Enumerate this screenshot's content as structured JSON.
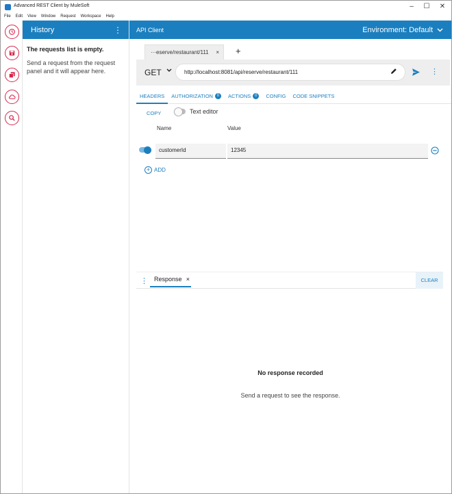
{
  "window": {
    "title": "Advanced REST Client by MuleSoft"
  },
  "menu": [
    "File",
    "Edit",
    "View",
    "Window",
    "Request",
    "Workspace",
    "Help"
  ],
  "colors": {
    "brand": "#1b7fbf",
    "rail_accent": "#d8244a"
  },
  "rail": [
    {
      "name": "history-icon"
    },
    {
      "name": "save-icon"
    },
    {
      "name": "projects-icon"
    },
    {
      "name": "cloud-icon"
    },
    {
      "name": "search-icon"
    }
  ],
  "history": {
    "title": "History",
    "empty_title": "The requests list is empty.",
    "empty_desc": "Send a request from the request panel and it will appear here."
  },
  "main": {
    "title": "API Client",
    "environment": "Environment: Default",
    "tab_label": "···eserve/restaurant/111",
    "tab_close": "×",
    "add_tab": "+",
    "method": "GET",
    "url": "http://localhost:8081/api/reserve/restaurant/111",
    "subtabs": [
      {
        "label": "HEADERS",
        "badge": ""
      },
      {
        "label": "AUTHORIZATION",
        "badge": "0"
      },
      {
        "label": "ACTIONS",
        "badge": "0"
      },
      {
        "label": "CONFIG",
        "badge": ""
      },
      {
        "label": "CODE SNIPPETS",
        "badge": ""
      }
    ],
    "copy_label": "COPY",
    "text_editor_label": "Text editor",
    "col_name": "Name",
    "col_value": "Value",
    "header_row": {
      "name": "customerId",
      "value": "12345"
    },
    "add_label": "ADD"
  },
  "response": {
    "tab_label": "Response",
    "tab_close": "×",
    "clear_label": "CLEAR",
    "empty_title": "No response recorded",
    "empty_hint": "Send a request to see the response."
  }
}
